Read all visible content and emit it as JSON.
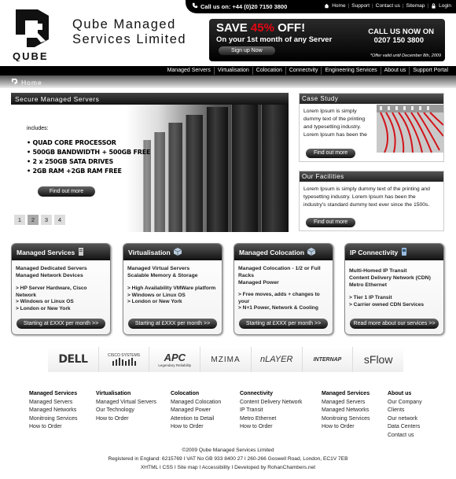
{
  "topbar": {
    "phone": "Call us on: +44 (0)20 7150 3800",
    "links": [
      "Home",
      "Support",
      "Contact us",
      "Sitemap",
      "Login"
    ]
  },
  "brand": {
    "line1": "Qube Managed",
    "line2": "Services Limited",
    "logo_text": "QUBE"
  },
  "promo": {
    "save_prefix": "SAVE ",
    "save_pct": "45%",
    "save_suffix": " OFF!",
    "subtitle": "On your 1st month of any Server",
    "signup": "Sign up Now",
    "call_line1": "CALL US NOW ON",
    "call_line2": "0207 150 3800",
    "offer_note": "*Offer valid until December 8th, 2009"
  },
  "nav": [
    "Managed Servers",
    "Virtualisation",
    "Colocation",
    "Connectvity",
    "Engineering Services",
    "About us",
    "Support Portal"
  ],
  "breadcrumb": {
    "home": "Home"
  },
  "hero": {
    "title": "Secure Managed Servers",
    "includes": "includes:",
    "bullets": [
      "QUAD CORE PROCESSOR",
      "500GB BANDWIDTH + 500GB FREE",
      "2 x 250GB SATA DRIVES",
      "2GB RAM +2GB RAM FREE"
    ],
    "button": "Find out more",
    "pages": [
      "1",
      "2",
      "3",
      "4"
    ]
  },
  "case_study": {
    "title": "Case Study",
    "text1": "Lorem Ipsum is simply",
    "text2": "dummy text of the printing",
    "text3": "and typesetting industry.",
    "text4": "Lorem Ipsum has been the",
    "button": "Find out more"
  },
  "facilities": {
    "title": "Our Facilities",
    "text1": "Lorem Ipsum is simply dummy text of the printing and",
    "text2": "typesetting industry. Lorem Ipsum has been the",
    "text3": "industry's standard dummy text ever since the 1500s.",
    "button": "Find out more"
  },
  "cards": [
    {
      "title": "Managed Services",
      "lead1": "Managed Dedicated Servers",
      "lead2": "Managed Network Devices",
      "lead3": "",
      "items": [
        "> HP Server Hardware, Cisco Network",
        "> Windows or Linux OS",
        ">  London  or  New York"
      ],
      "button": "Starting at £XXX per month >>"
    },
    {
      "title": "Virtualisation",
      "lead1": "Managed Virtual Servers",
      "lead2": "Scalable Memory & Storage",
      "lead3": "",
      "items": [
        "> High Availability VMWare platform",
        "> Windows or Linux OS",
        ">  London  or  New York"
      ],
      "button": "Starting at £XXX per month >>"
    },
    {
      "title": "Managed Colocation",
      "lead1": "Managed Colocation - 1/2 or Full",
      "lead2": "Racks",
      "lead3": "Managed Power",
      "items": [
        "> Free moves, adds + changes to your",
        "> N+1 Power, Network & Cooling"
      ],
      "button": "Starting at £XXX per month >>"
    },
    {
      "title": "IP Connectivity",
      "lead1": "Multi-Homed IP Transit",
      "lead2": "Content Delivery Network (CDN)",
      "lead3": "Metro Ethernet",
      "items": [
        "> Tier 1 IP Transit",
        "> Carrier owned CDN Services"
      ],
      "button": "Read more about our services >>"
    }
  ],
  "partners": [
    "DELL",
    "CISCO SYSTEMS",
    "APC",
    "MZIMA",
    "nLAYER",
    "INTERNAP",
    "sFlow"
  ],
  "partner_sub": {
    "apc": "Legendary Reliability"
  },
  "footer_cols": [
    {
      "heading": "Managed Services",
      "links": [
        "Managed Servers",
        "Managed Networks",
        "Monitroing Services",
        "How to Order"
      ]
    },
    {
      "heading": "Virtualisation",
      "links": [
        "Managed Virtual Servers",
        "Our Technology",
        "How to Order"
      ]
    },
    {
      "heading": "Colocation",
      "links": [
        "Managed Colocation",
        "Managed Power",
        "Attention to Detail",
        "How to Order"
      ]
    },
    {
      "heading": "Connectivity",
      "links": [
        "Content Delivery Network",
        "IP Transit",
        "Metro Ethernet",
        "How to Order"
      ]
    },
    {
      "heading": "Managed Services",
      "links": [
        "Managed Servers",
        "Managed Networks",
        "Monitroing Services",
        "How to Order"
      ]
    },
    {
      "heading": "About us",
      "links": [
        "Our Company",
        "Clients",
        "Our network",
        "Data Centers",
        "Contact us"
      ]
    }
  ],
  "copyright": {
    "line1": "©2009 Qube Managed Services Limited",
    "line2": "Registered in England: 6215769 I VAT No GB 933 8400 27 I 260-266 Goswell Road, London, EC1V 7EB",
    "line3": "XHTML I CSS I Site map I Accessibility I Developed by RohanChambers.net"
  },
  "colors": {
    "accent_red": "#e30613",
    "dark": "#111111"
  }
}
